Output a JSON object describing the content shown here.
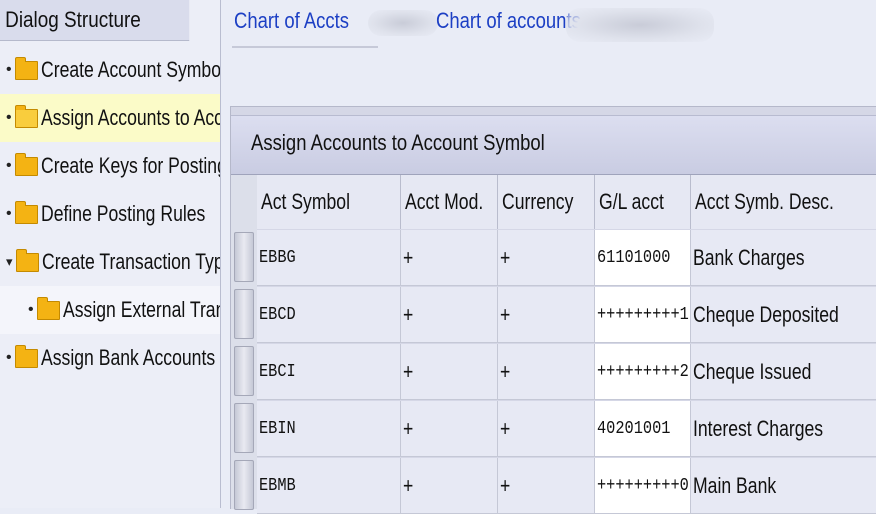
{
  "dialog_structure": {
    "title": "Dialog Structure",
    "items": [
      {
        "label": "Create Account Symbols",
        "level": 1,
        "marker": "•",
        "selected": false
      },
      {
        "label": "Assign Accounts to Account Symbol",
        "level": 1,
        "marker": "•",
        "selected": true
      },
      {
        "label": "Create Keys for Posting Rules",
        "level": 1,
        "marker": "•",
        "selected": false
      },
      {
        "label": "Define Posting Rules",
        "level": 1,
        "marker": "•",
        "selected": false
      },
      {
        "label": "Create Transaction Types",
        "level": 1,
        "marker": "▾",
        "selected": false
      },
      {
        "label": "Assign External Transaction Types",
        "level": 2,
        "marker": "•",
        "selected": false
      },
      {
        "label": "Assign Bank Accounts to Transaction Types",
        "level": 1,
        "marker": "•",
        "selected": false
      }
    ]
  },
  "header": {
    "chart_label": "Chart of Accts",
    "chart_name_label": "Chart of accounts"
  },
  "panel": {
    "title": "Assign Accounts to Account Symbol",
    "columns": [
      "Act Symbol",
      "Acct Mod.",
      "Currency",
      "G/L acct",
      "Acct Symb. Desc."
    ],
    "rows": [
      {
        "symbol": "EBBG",
        "mod": "+",
        "currency": "+",
        "gl": "61101000",
        "desc": "Bank Charges"
      },
      {
        "symbol": "EBCD",
        "mod": "+",
        "currency": "+",
        "gl": "+++++++++1",
        "desc": "Cheque Deposited"
      },
      {
        "symbol": "EBCI",
        "mod": "+",
        "currency": "+",
        "gl": "+++++++++2",
        "desc": "Cheque Issued"
      },
      {
        "symbol": "EBIN",
        "mod": "+",
        "currency": "+",
        "gl": "40201001",
        "desc": "Interest Charges"
      },
      {
        "symbol": "EBMB",
        "mod": "+",
        "currency": "+",
        "gl": "+++++++++0",
        "desc": "Main Bank"
      }
    ]
  },
  "icons": {
    "folder": "folder-icon",
    "folder_open": "folder-open-icon"
  },
  "colors": {
    "link": "#1c3fc4",
    "folder": "#f4b313",
    "selection": "#fbfbc8"
  }
}
